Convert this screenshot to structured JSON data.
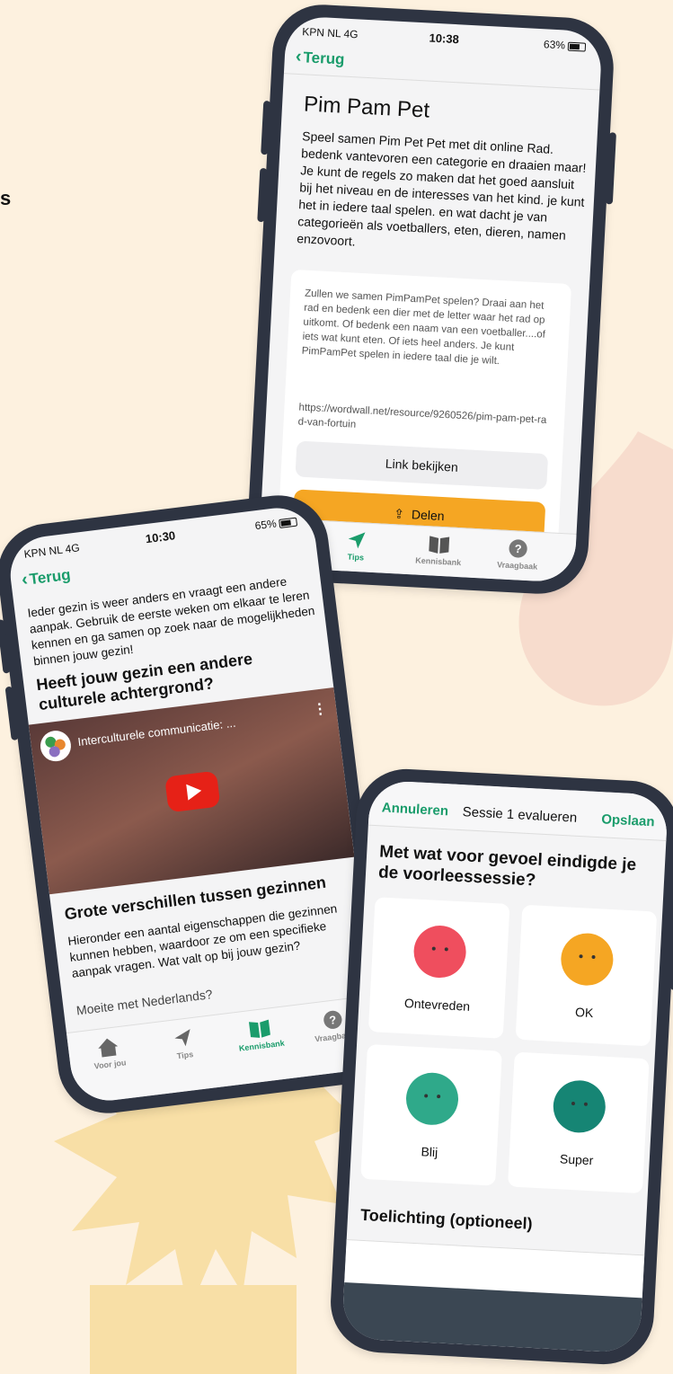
{
  "colors": {
    "background": "#fdf1df",
    "phone_frame": "#2e3442",
    "accent_green": "#1a9c6b",
    "accent_orange": "#f5a623",
    "blob_pink": "#f7dccd",
    "burst_yellow": "#f8dfa6"
  },
  "fragment_text": "s",
  "phone_top": {
    "status": {
      "carrier": "KPN NL  4G",
      "time": "10:38",
      "battery": "63%"
    },
    "back_label": "Terug",
    "title": "Pim Pam Pet",
    "intro": "Speel samen Pim Pet Pet met dit online Rad. bedenk vantevoren een categorie en draaien maar! Je kunt de regels zo maken dat het goed aansluit bij het niveau en de interesses van het kind. je kunt het in iedere taal spelen. en wat dacht je van categorieën als voetballers, eten, dieren, namen enzovoort.",
    "card_text": "Zullen we samen PimPamPet spelen? Draai aan het rad en bedenk een dier met de letter waar het rad op uitkomt. Of bedenk een naam van een voetballer....of iets wat kunt eten. Of iets heel anders. Je kunt PimPamPet spelen in iedere taal die je wilt.",
    "card_link": "https://wordwall.net/resource/9260526/pim-pam-pet-rad-van-fortuin",
    "link_button": "Link bekijken",
    "share_button": "Delen",
    "tabs": [
      {
        "label": "Tips",
        "icon": "paper-plane-icon"
      },
      {
        "label": "Kennisbank",
        "icon": "book-icon"
      },
      {
        "label": "Vraagbaak",
        "icon": "question-icon"
      }
    ]
  },
  "phone_left": {
    "status": {
      "carrier": "KPN NL  4G",
      "time": "10:30",
      "battery": "65%"
    },
    "back_label": "Terug",
    "intro": "Ieder gezin is weer anders en vraagt een andere aanpak. Gebruik de eerste weken om elkaar te leren kennen en ga samen op zoek naar de mogelijkheden binnen jouw gezin!",
    "heading": "Heeft jouw gezin een andere culturele achtergrond?",
    "video_title": "Interculturele communicatie: ...",
    "section_title": "Grote verschillen tussen gezinnen",
    "section_text": "Hieronder een aantal eigenschappen die gezinnen kunnen hebben, waardoor ze om een specifieke aanpak vragen. Wat valt op bij jouw gezin?",
    "cut_text": "Moeite met Nederlands?",
    "tabs": [
      {
        "label": "Voor jou",
        "icon": "home-icon"
      },
      {
        "label": "Tips",
        "icon": "paper-plane-icon"
      },
      {
        "label": "Kennisbank",
        "icon": "book-icon"
      },
      {
        "label": "Vraagbaak",
        "icon": "question-icon"
      }
    ]
  },
  "phone_right": {
    "cancel": "Annuleren",
    "title": "Sessie 1 evalueren",
    "save": "Opslaan",
    "question": "Met wat voor gevoel eindigde je de voorleessessie?",
    "moods": [
      {
        "label": "Ontevreden",
        "color": "#ef4e5e"
      },
      {
        "label": "OK",
        "color": "#f5a623"
      },
      {
        "label": "Blij",
        "color": "#2fa98a"
      },
      {
        "label": "Super",
        "color": "#168574"
      }
    ],
    "notes_heading": "Toelichting (optioneel)"
  }
}
